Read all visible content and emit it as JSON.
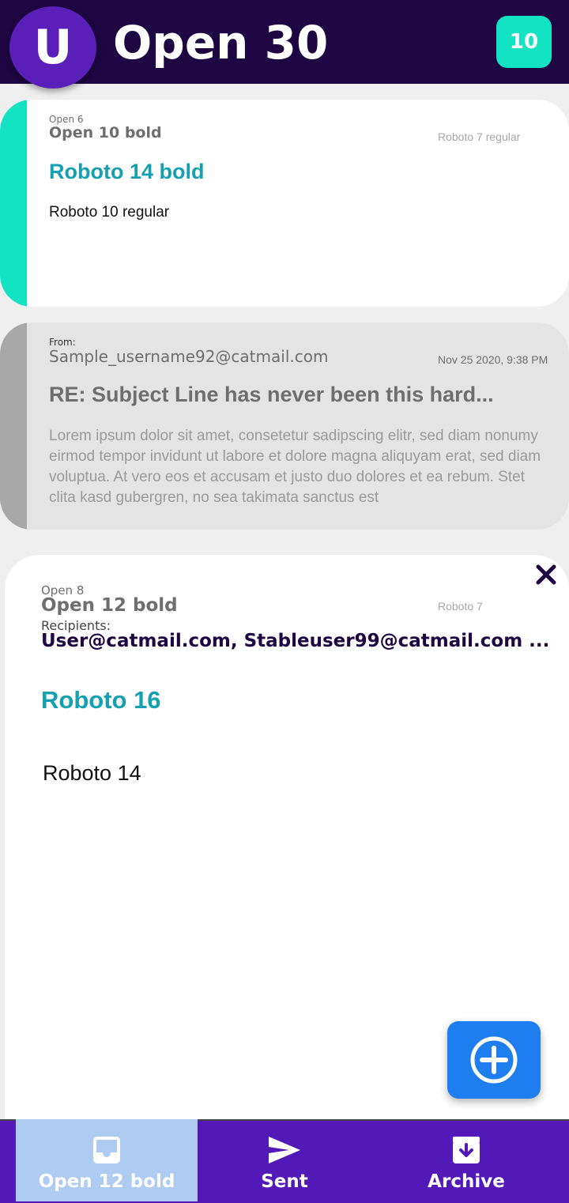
{
  "header": {
    "avatar_letter": "U",
    "title": "Open 30",
    "count": "10"
  },
  "messages": [
    {
      "label": "Open 6",
      "sender": "Open 10 bold",
      "date": "Roboto 7 regular",
      "subject": "Roboto 14 bold",
      "body": "Roboto 10 regular",
      "stripe_color": "#13e3c3"
    },
    {
      "label": "From:",
      "sender": "Sample_username92@catmail.com",
      "date": "Nov 25 2020, 9:38 PM",
      "subject": "RE: Subject Line has never been this hard...",
      "body": "Lorem ipsum dolor sit amet, consetetur sadipscing elitr, sed diam nonumy eirmod tempor invidunt ut labore et dolore magna aliquyam erat, sed diam voluptua. At vero eos et accusam et justo duo dolores et ea rebum. Stet clita kasd gubergren, no sea takimata sanctus est",
      "stripe_color": "#a8a8a8"
    }
  ],
  "detail": {
    "label": "Open 8",
    "sender": "Open 12 bold",
    "date": "Roboto 7",
    "recipients_label": "Recipients:",
    "recipients": "User@catmail.com, Stableuser99@catmail.com ...",
    "subject": "Roboto 16",
    "body": "Roboto 14"
  },
  "bottom_nav": {
    "tabs": [
      {
        "label": "Open 12 bold",
        "icon": "inbox-icon",
        "active": true
      },
      {
        "label": "Sent",
        "icon": "send-icon",
        "active": false
      },
      {
        "label": "Archive",
        "icon": "archive-icon",
        "active": false
      }
    ]
  },
  "colors": {
    "header_bg": "#1d0642",
    "accent_teal": "#13e3c3",
    "subject_teal": "#14a0b0",
    "fab_blue": "#1e7ef0",
    "nav_purple": "#5319b8",
    "nav_active": "#aecbf2"
  }
}
